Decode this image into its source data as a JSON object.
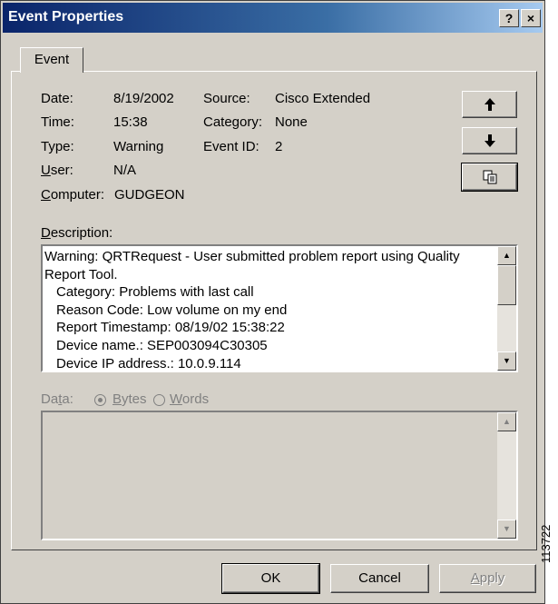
{
  "window": {
    "title": "Event Properties",
    "help_label": "?",
    "close_label": "×"
  },
  "tab": {
    "label": "Event"
  },
  "fields": {
    "date_label": "Date:",
    "date_value": "8/19/2002",
    "time_label": "Time:",
    "time_value": "15:38",
    "type_label": "Type:",
    "type_value": "Warning",
    "user_label_hotkey": "U",
    "user_label_rest": "ser:",
    "user_value": "N/A",
    "computer_label_hotkey": "C",
    "computer_label_rest": "omputer:",
    "computer_value": "GUDGEON",
    "source_label": "Source:",
    "source_value": "Cisco Extended",
    "category_label": "Category:",
    "category_value": "None",
    "eventid_label": "Event ID:",
    "eventid_value": "2"
  },
  "nav": {
    "up_icon": "arrow-up-icon",
    "down_icon": "arrow-down-icon",
    "copy_icon": "copy-icon"
  },
  "description": {
    "label_hotkey": "D",
    "label_rest": "escription:",
    "lines": [
      "Warning: QRTRequest - User submitted problem report using Quality",
      "Report Tool.",
      "  Category: Problems with last call",
      "  Reason Code: Low volume on my end",
      "  Report Timestamp: 08/19/02 15:38:22",
      "  Device name.: SEP003094C30305",
      "  Device IP address.: 10.0.9.114"
    ]
  },
  "data_section": {
    "label_pre": "Da",
    "label_hotkey": "t",
    "label_post": "a:",
    "bytes_hotkey": "B",
    "bytes_rest": "ytes",
    "words_hotkey": "W",
    "words_rest": "ords",
    "selected": "Bytes"
  },
  "buttons": {
    "ok": "OK",
    "cancel": "Cancel",
    "apply_hotkey": "A",
    "apply_rest": "pply"
  },
  "figure_id": "113722"
}
